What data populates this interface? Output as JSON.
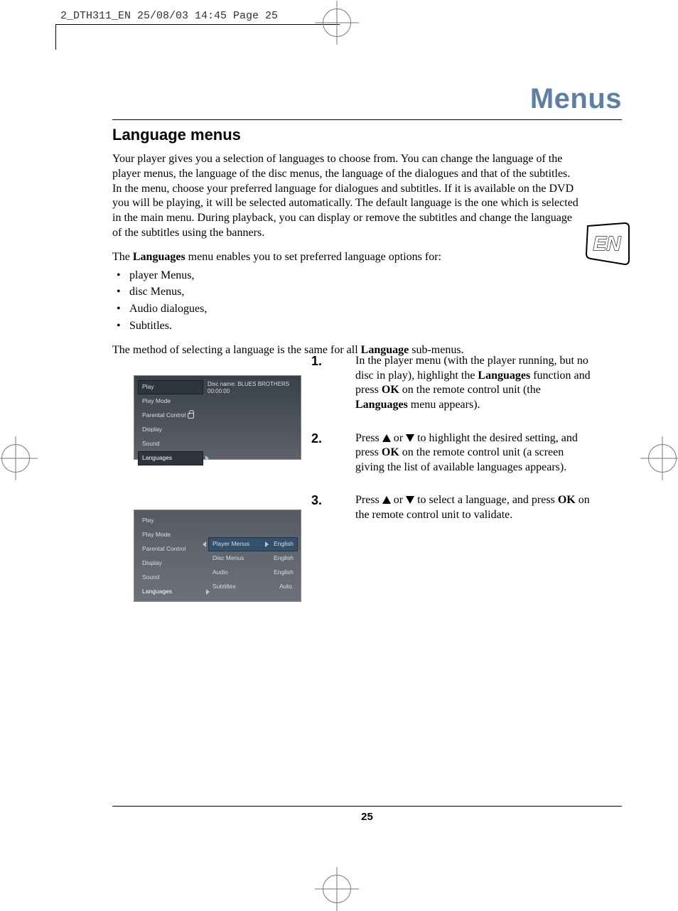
{
  "header": "2_DTH311_EN  25/08/03  14:45  Page 25",
  "page_title": "Menus",
  "section_heading": "Language menus",
  "intro_para": "Your player gives you a selection of languages to choose from. You can change the language of the player menus, the language of the disc menus, the language of the dialogues and that of the subtitles. In the menu, choose your preferred language for dialogues and subtitles. If it is available on the DVD you will be playing, it will be selected automatically. The default language is the one which is selected in the main menu. During playback, you can display or remove the subtitles and change the language of the subtitles using the banners.",
  "list_intro_pre": "The ",
  "list_intro_bold": "Languages",
  "list_intro_post": " menu enables you to set preferred language options for:",
  "bullets": [
    "player Menus,",
    "disc Menus,",
    "Audio dialogues,",
    "Subtitles."
  ],
  "method_para_pre": "The method of selecting a language is the same for all ",
  "method_para_bold": "Language",
  "method_para_post": " sub-menus.",
  "screenshot1": {
    "disc_label": "Disc name: BLUES BROTHERS",
    "time": "00:00:00",
    "items": [
      "Play",
      "Play Mode",
      "Parental Control",
      "Display",
      "Sound",
      "Languages"
    ]
  },
  "screenshot2": {
    "items": [
      "Play",
      "Play Mode",
      "Parental Control",
      "Display",
      "Sound",
      "Languages"
    ],
    "submenu": [
      {
        "label": "Player Menus",
        "value": "English"
      },
      {
        "label": "Disc Menus",
        "value": "English"
      },
      {
        "label": "Audio",
        "value": "English"
      },
      {
        "label": "Subtitles",
        "value": "Auto."
      }
    ]
  },
  "steps": [
    {
      "num": "1.",
      "pre": "In the player menu (with the player running, but no disc in play), highlight the ",
      "b1": "Languages",
      "mid1": " function and press ",
      "b2": "OK",
      "mid2": " on the remote control unit (the ",
      "b3": "Languages",
      "post": " menu appears)."
    },
    {
      "num": "2.",
      "pre": "Press ",
      "arrows": true,
      "mid1": " to highlight the desired setting, and press ",
      "b1": "OK",
      "post": " on the remote control unit (a screen giving the list of available languages appears)."
    },
    {
      "num": "3.",
      "pre": "Press ",
      "arrows": true,
      "mid1": " to select a language, and press ",
      "b1": "OK",
      "post": " on the remote control unit to validate."
    }
  ],
  "page_number": "25",
  "lang_tab": "EN",
  "or_word": " or "
}
